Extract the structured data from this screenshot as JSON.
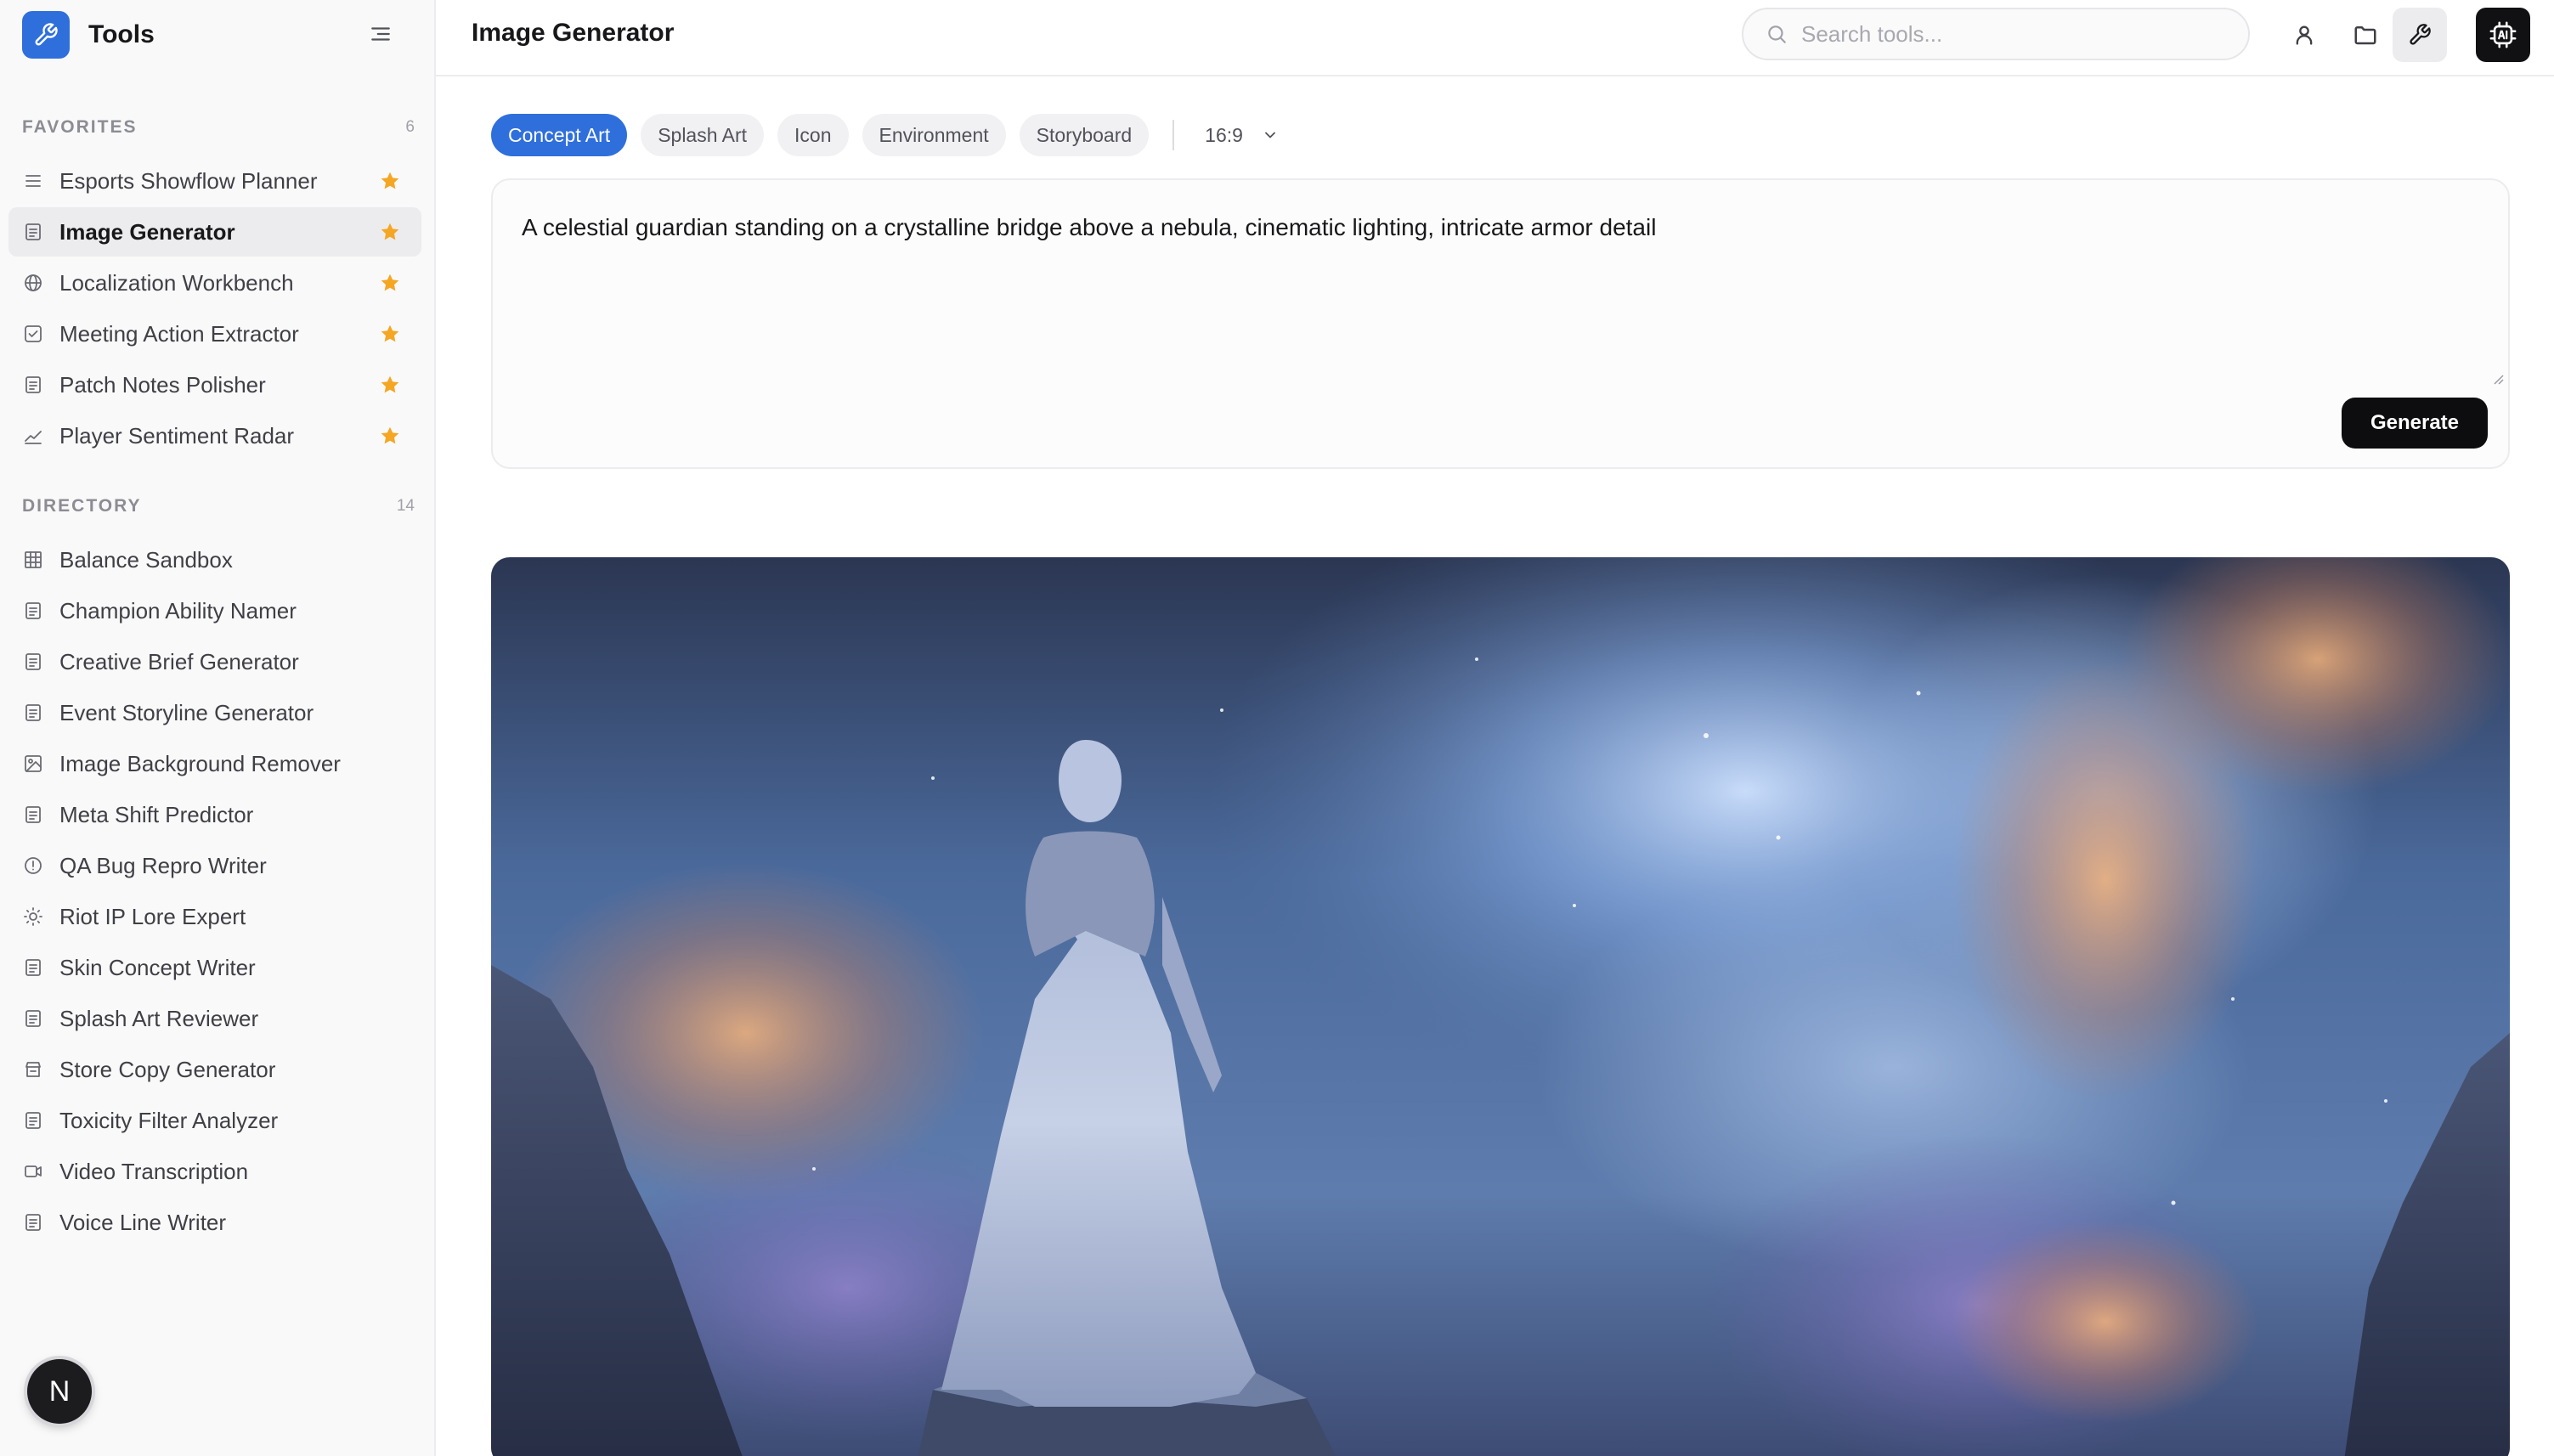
{
  "app": {
    "name": "Tools",
    "brand_color": "#2f6fdc"
  },
  "sidebar": {
    "favorites": {
      "title": "FAVORITES",
      "count": "6",
      "items": [
        {
          "label": "Esports Showflow Planner",
          "icon": "list-icon",
          "starred": true,
          "active": false
        },
        {
          "label": "Image Generator",
          "icon": "document-icon",
          "starred": true,
          "active": true
        },
        {
          "label": "Localization Workbench",
          "icon": "globe-icon",
          "starred": true,
          "active": false
        },
        {
          "label": "Meeting Action Extractor",
          "icon": "checkbox-icon",
          "starred": true,
          "active": false
        },
        {
          "label": "Patch Notes Polisher",
          "icon": "document-icon",
          "starred": true,
          "active": false
        },
        {
          "label": "Player Sentiment Radar",
          "icon": "chart-line-icon",
          "starred": true,
          "active": false
        }
      ]
    },
    "directory": {
      "title": "DIRECTORY",
      "count": "14",
      "items": [
        {
          "label": "Balance Sandbox",
          "icon": "table-icon"
        },
        {
          "label": "Champion Ability Namer",
          "icon": "document-icon"
        },
        {
          "label": "Creative Brief Generator",
          "icon": "document-icon"
        },
        {
          "label": "Event Storyline Generator",
          "icon": "document-icon"
        },
        {
          "label": "Image Background Remover",
          "icon": "image-icon"
        },
        {
          "label": "Meta Shift Predictor",
          "icon": "document-icon"
        },
        {
          "label": "QA Bug Repro Writer",
          "icon": "alert-circle-icon"
        },
        {
          "label": "Riot IP Lore Expert",
          "icon": "sun-icon"
        },
        {
          "label": "Skin Concept Writer",
          "icon": "document-icon"
        },
        {
          "label": "Splash Art Reviewer",
          "icon": "document-icon"
        },
        {
          "label": "Store Copy Generator",
          "icon": "store-icon"
        },
        {
          "label": "Toxicity Filter Analyzer",
          "icon": "document-icon"
        },
        {
          "label": "Video Transcription",
          "icon": "video-icon"
        },
        {
          "label": "Voice Line Writer",
          "icon": "document-icon"
        }
      ]
    },
    "user_initial": "N"
  },
  "header": {
    "title": "Image Generator",
    "search_placeholder": "Search tools...",
    "icons": [
      "user-icon",
      "folder-icon",
      "wrench-icon",
      "ai-chip-icon"
    ]
  },
  "generator": {
    "styles": [
      "Concept Art",
      "Splash Art",
      "Icon",
      "Environment",
      "Storyboard"
    ],
    "selected_style": "Concept Art",
    "aspect_ratio": "16:9",
    "prompt": "A celestial guardian standing on a crystalline bridge above a nebula, cinematic lighting, intricate armor detail",
    "generate_label": "Generate"
  },
  "colors": {
    "accent": "#2f6fdc",
    "star": "#f5a623",
    "primary_button": "#0d0d0f"
  }
}
